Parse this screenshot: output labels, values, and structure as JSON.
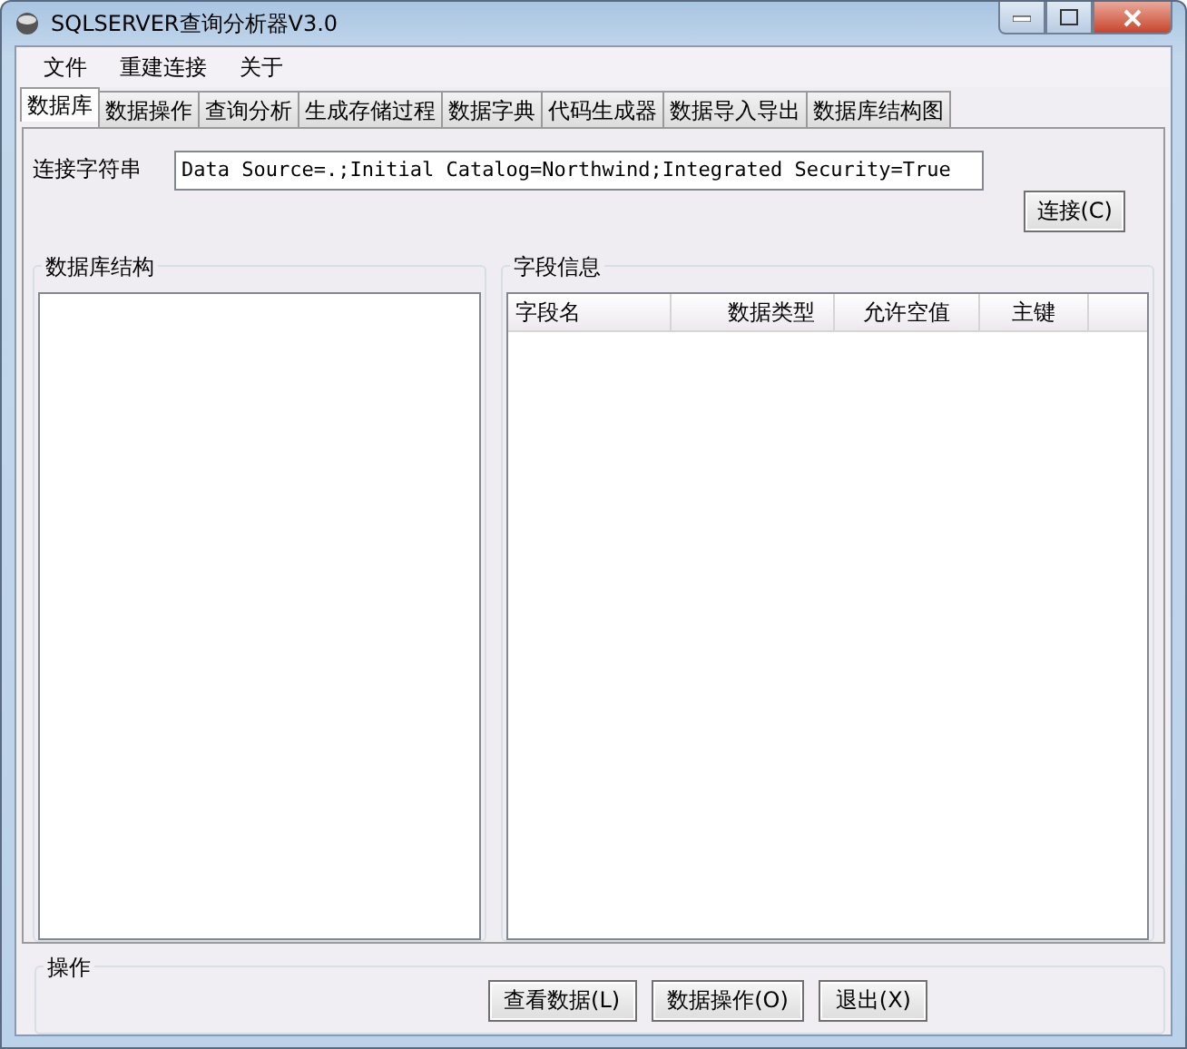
{
  "window": {
    "title": "SQLSERVER查询分析器V3.0"
  },
  "menu": [
    "文件",
    "重建连接",
    "关于"
  ],
  "tabs": [
    {
      "label": "数据库",
      "selected": true
    },
    {
      "label": "数据操作",
      "selected": false
    },
    {
      "label": "查询分析",
      "selected": false
    },
    {
      "label": "生成存储过程",
      "selected": false
    },
    {
      "label": "数据字典",
      "selected": false
    },
    {
      "label": "代码生成器",
      "selected": false
    },
    {
      "label": "数据导入导出",
      "selected": false
    },
    {
      "label": "数据库结构图",
      "selected": false
    }
  ],
  "connection": {
    "label": "连接字符串",
    "value": "Data Source=.;Initial Catalog=Northwind;Integrated Security=True",
    "button": "连接(C)"
  },
  "db_structure": {
    "title": "数据库结构"
  },
  "field_info": {
    "title": "字段信息",
    "columns": [
      "字段名",
      "数据类型",
      "允许空值",
      "主键"
    ]
  },
  "actions": {
    "title": "操作",
    "buttons": [
      "查看数据(L)",
      "数据操作(O)",
      "退出(X)"
    ]
  }
}
